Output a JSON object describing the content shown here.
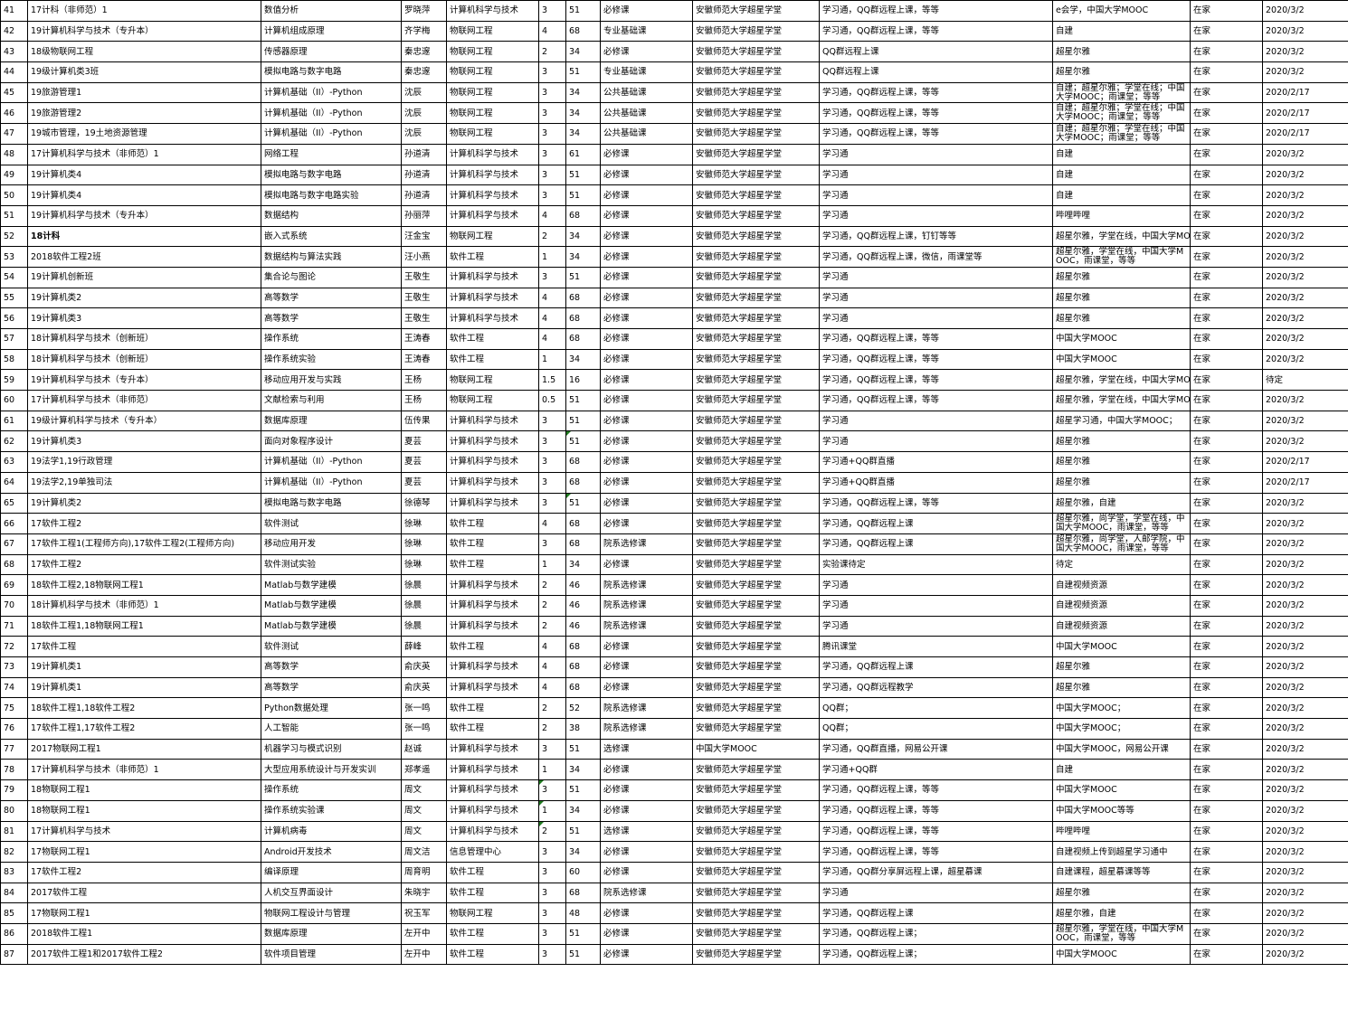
{
  "rows": [
    [
      "41",
      "17计科（非师范）1",
      "数值分析",
      "罗晓萍",
      "计算机科学与技术",
      "3",
      "51",
      "必修课",
      "安徽师范大学超星学堂",
      "学习通，QQ群远程上课，等等",
      "e会学，中国大学MOOC",
      "在家",
      "2020/3/2"
    ],
    [
      "42",
      "19计算机科学与技术（专升本）",
      "计算机组成原理",
      "齐学梅",
      "物联网工程",
      "4",
      "68",
      "专业基础课",
      "安徽师范大学超星学堂",
      "学习通，QQ群远程上课，等等",
      "自建",
      "在家",
      "2020/3/2"
    ],
    [
      "43",
      "18级物联网工程",
      "传感器原理",
      "秦忠邃",
      "物联网工程",
      "2",
      "34",
      "必修课",
      "安徽师范大学超星学堂",
      "QQ群远程上课",
      "超星尔雅",
      "在家",
      "2020/3/2"
    ],
    [
      "44",
      "19级计算机类3班",
      "模拟电路与数字电路",
      "秦忠邃",
      "物联网工程",
      "3",
      "51",
      "专业基础课",
      "安徽师范大学超星学堂",
      "QQ群远程上课",
      "超星尔雅",
      "在家",
      "2020/3/2"
    ],
    [
      "45",
      "19旅游管理1",
      "计算机基础（II）-Python",
      "沈辰",
      "物联网工程",
      "3",
      "34",
      "公共基础课",
      "安徽师范大学超星学堂",
      "学习通，QQ群远程上课，等等",
      "自建；超星尔雅；学堂在线；中国大学MOOC；雨课堂；等等",
      "在家",
      "2020/2/17"
    ],
    [
      "46",
      "19旅游管理2",
      "计算机基础（II）-Python",
      "沈辰",
      "物联网工程",
      "3",
      "34",
      "公共基础课",
      "安徽师范大学超星学堂",
      "学习通，QQ群远程上课，等等",
      "自建；超星尔雅；学堂在线；中国大学MOOC；雨课堂；等等",
      "在家",
      "2020/2/17"
    ],
    [
      "47",
      "19城市管理，19土地资源管理",
      "计算机基础（II）-Python",
      "沈辰",
      "物联网工程",
      "3",
      "34",
      "公共基础课",
      "安徽师范大学超星学堂",
      "学习通，QQ群远程上课，等等",
      "自建；超星尔雅；学堂在线；中国大学MOOC；雨课堂；等等",
      "在家",
      "2020/2/17"
    ],
    [
      "48",
      "17计算机科学与技术（非师范）1",
      "网络工程",
      "孙道清",
      "计算机科学与技术",
      "3",
      "61",
      "必修课",
      "安徽师范大学超星学堂",
      "学习通",
      "自建",
      "在家",
      "2020/3/2"
    ],
    [
      "49",
      "19计算机类4",
      "模拟电路与数字电路",
      "孙道清",
      "计算机科学与技术",
      "3",
      "51",
      "必修课",
      "安徽师范大学超星学堂",
      "学习通",
      "自建",
      "在家",
      "2020/3/2"
    ],
    [
      "50",
      "19计算机类4",
      "模拟电路与数字电路实验",
      "孙道清",
      "计算机科学与技术",
      "3",
      "51",
      "必修课",
      "安徽师范大学超星学堂",
      "学习通",
      "自建",
      "在家",
      "2020/3/2"
    ],
    [
      "51",
      "19计算机科学与技术（专升本）",
      "数据结构",
      "孙丽萍",
      "计算机科学与技术",
      "4",
      "68",
      "必修课",
      "安徽师范大学超星学堂",
      "学习通",
      "哔哩哔哩",
      "在家",
      "2020/3/2"
    ],
    [
      "52",
      "18计科",
      "嵌入式系统",
      "汪金宝",
      "物联网工程",
      "2",
      "34",
      "必修课",
      "安徽师范大学超星学堂",
      "学习通，QQ群远程上课，钉钉等等",
      "超星尔雅，学堂在线，中国大学MOOC",
      "在家",
      "2020/3/2"
    ],
    [
      "53",
      "2018软件工程2班",
      "数据结构与算法实践",
      "汪小燕",
      "软件工程",
      "1",
      "34",
      "必修课",
      "安徽师范大学超星学堂",
      "学习通，QQ群远程上课，微信，雨课堂等",
      "超星尔雅，学堂在线，中国大学MOOC，雨课堂，等等",
      "在家",
      "2020/3/2"
    ],
    [
      "54",
      "19计算机创新班",
      "集合论与图论",
      "王敬生",
      "计算机科学与技术",
      "3",
      "51",
      "必修课",
      "安徽师范大学超星学堂",
      "学习通",
      "超星尔雅",
      "在家",
      "2020/3/2"
    ],
    [
      "55",
      "19计算机类2",
      "高等数学",
      "王敬生",
      "计算机科学与技术",
      "4",
      "68",
      "必修课",
      "安徽师范大学超星学堂",
      "学习通",
      "超星尔雅",
      "在家",
      "2020/3/2"
    ],
    [
      "56",
      "19计算机类3",
      "高等数学",
      "王敬生",
      "计算机科学与技术",
      "4",
      "68",
      "必修课",
      "安徽师范大学超星学堂",
      "学习通",
      "超星尔雅",
      "在家",
      "2020/3/2"
    ],
    [
      "57",
      "18计算机科学与技术（创新班）",
      "操作系统",
      "王涛春",
      "软件工程",
      "4",
      "68",
      "必修课",
      "安徽师范大学超星学堂",
      "学习通，QQ群远程上课，等等",
      "中国大学MOOC",
      "在家",
      "2020/3/2"
    ],
    [
      "58",
      "18计算机科学与技术（创新班）",
      "操作系统实验",
      "王涛春",
      "软件工程",
      "1",
      "34",
      "必修课",
      "安徽师范大学超星学堂",
      "学习通，QQ群远程上课，等等",
      "中国大学MOOC",
      "在家",
      "2020/3/2"
    ],
    [
      "59",
      "19计算机科学与技术（专升本）",
      "移动应用开发与实践",
      "王杨",
      "物联网工程",
      "1.5",
      "16",
      "必修课",
      "安徽师范大学超星学堂",
      "学习通，QQ群远程上课，等等",
      "超星尔雅，学堂在线，中国大学MOOC",
      "在家",
      "待定"
    ],
    [
      "60",
      "17计算机科学与技术（非师范）",
      "文献检索与利用",
      "王杨",
      "物联网工程",
      "0.5",
      "51",
      "必修课",
      "安徽师范大学超星学堂",
      "学习通，QQ群远程上课，等等",
      "超星尔雅，学堂在线，中国大学MOOC",
      "在家",
      "2020/3/2"
    ],
    [
      "61",
      "19级计算机科学与技术（专升本）",
      "数据库原理",
      "伍传果",
      "计算机科学与技术",
      "3",
      "51",
      "必修课",
      "安徽师范大学超星学堂",
      "学习通",
      "超星学习通，中国大学MOOC；",
      "在家",
      "2020/3/2"
    ],
    [
      "62",
      "19计算机类3",
      "面向对象程序设计",
      "夏芸",
      "计算机科学与技术",
      "3",
      "51",
      "必修课",
      "安徽师范大学超星学堂",
      "学习通",
      "超星尔雅",
      "在家",
      "2020/3/2"
    ],
    [
      "63",
      "19法学1,19行政管理",
      "计算机基础（II）-Python",
      "夏芸",
      "计算机科学与技术",
      "3",
      "68",
      "必修课",
      "安徽师范大学超星学堂",
      "学习通+QQ群直播",
      "超星尔雅",
      "在家",
      "2020/2/17"
    ],
    [
      "64",
      "19法学2,19单独司法",
      "计算机基础（II）-Python",
      "夏芸",
      "计算机科学与技术",
      "3",
      "68",
      "必修课",
      "安徽师范大学超星学堂",
      "学习通+QQ群直播",
      "超星尔雅",
      "在家",
      "2020/2/17"
    ],
    [
      "65",
      "19计算机类2",
      "模拟电路与数字电路",
      "徐德琴",
      "计算机科学与技术",
      "3",
      "51",
      "必修课",
      "安徽师范大学超星学堂",
      "学习通，QQ群远程上课，等等",
      "超星尔雅，自建",
      "在家",
      "2020/3/2"
    ],
    [
      "66",
      "17软件工程2",
      "软件测试",
      "徐琳",
      "软件工程",
      "4",
      "68",
      "必修课",
      "安徽师范大学超星学堂",
      "学习通，QQ群远程上课",
      "超星尔雅，尚学堂，学堂在线，中国大学MOOC，雨课堂，等等",
      "在家",
      "2020/3/2"
    ],
    [
      "67",
      "17软件工程1(工程师方向),17软件工程2(工程师方向)",
      "移动应用开发",
      "徐琳",
      "软件工程",
      "3",
      "68",
      "院系选修课",
      "安徽师范大学超星学堂",
      "学习通，QQ群远程上课",
      "超星尔雅，尚学堂，人邮学院，中国大学MOOC，雨课堂，等等",
      "在家",
      "2020/3/2"
    ],
    [
      "68",
      "17软件工程2",
      "软件测试实验",
      "徐琳",
      "软件工程",
      "1",
      "34",
      "必修课",
      "安徽师范大学超星学堂",
      "实验课待定",
      "待定",
      "在家",
      "2020/3/2"
    ],
    [
      "69",
      "18软件工程2,18物联网工程1",
      "Matlab与数学建模",
      "徐晨",
      "计算机科学与技术",
      "2",
      "46",
      "院系选修课",
      "安徽师范大学超星学堂",
      "学习通",
      "自建视频资源",
      "在家",
      "2020/3/2"
    ],
    [
      "70",
      "18计算机科学与技术（非师范）1",
      "Matlab与数学建模",
      "徐晨",
      "计算机科学与技术",
      "2",
      "46",
      "院系选修课",
      "安徽师范大学超星学堂",
      "学习通",
      "自建视频资源",
      "在家",
      "2020/3/2"
    ],
    [
      "71",
      "18软件工程1,18物联网工程1",
      "Matlab与数学建模",
      "徐晨",
      "计算机科学与技术",
      "2",
      "46",
      "院系选修课",
      "安徽师范大学超星学堂",
      "学习通",
      "自建视频资源",
      "在家",
      "2020/3/2"
    ],
    [
      "72",
      "17软件工程",
      "软件测试",
      "薛峰",
      "软件工程",
      "4",
      "68",
      "必修课",
      "安徽师范大学超星学堂",
      "腾讯课堂",
      "中国大学MOOC",
      "在家",
      "2020/3/2"
    ],
    [
      "73",
      "19计算机类1",
      "高等数学",
      "俞庆英",
      "计算机科学与技术",
      "4",
      "68",
      "必修课",
      "安徽师范大学超星学堂",
      "学习通，QQ群远程上课",
      "超星尔雅",
      "在家",
      "2020/3/2"
    ],
    [
      "74",
      "19计算机类1",
      "高等数学",
      "俞庆英",
      "计算机科学与技术",
      "4",
      "68",
      "必修课",
      "安徽师范大学超星学堂",
      "学习通，QQ群远程教学",
      "超星尔雅",
      "在家",
      "2020/3/2"
    ],
    [
      "75",
      "18软件工程1,18软件工程2",
      "Python数据处理",
      "张一鸣",
      "软件工程",
      "2",
      "52",
      "院系选修课",
      "安徽师范大学超星学堂",
      "QQ群；",
      "中国大学MOOC；",
      "在家",
      "2020/3/2"
    ],
    [
      "76",
      "17软件工程1,17软件工程2",
      "人工智能",
      "张一鸣",
      "软件工程",
      "2",
      "38",
      "院系选修课",
      "安徽师范大学超星学堂",
      "QQ群；",
      "中国大学MOOC；",
      "在家",
      "2020/3/2"
    ],
    [
      "77",
      "2017物联网工程1",
      "机器学习与模式识别",
      "赵诚",
      "计算机科学与技术",
      "3",
      "51",
      "选修课",
      "中国大学MOOC",
      "学习通，QQ群直播，网易公开课",
      "中国大学MOOC，网易公开课",
      "在家",
      "2020/3/2"
    ],
    [
      "78",
      "17计算机科学与技术（非师范）1",
      "大型应用系统设计与开发实训",
      "郑孝遥",
      "计算机科学与技术",
      "1",
      "34",
      "必修课",
      "安徽师范大学超星学堂",
      "学习通+QQ群",
      "自建",
      "在家",
      "2020/3/2"
    ],
    [
      "79",
      "18物联网工程1",
      "操作系统",
      "周文",
      "计算机科学与技术",
      "3",
      "51",
      "必修课",
      "安徽师范大学超星学堂",
      "学习通，QQ群远程上课，等等",
      "中国大学MOOC",
      "在家",
      "2020/3/2"
    ],
    [
      "80",
      "18物联网工程1",
      "操作系统实验课",
      "周文",
      "计算机科学与技术",
      "1",
      "34",
      "必修课",
      "安徽师范大学超星学堂",
      "学习通，QQ群远程上课，等等",
      "中国大学MOOC等等",
      "在家",
      "2020/3/2"
    ],
    [
      "81",
      "17计算机科学与技术",
      "计算机病毒",
      "周文",
      "计算机科学与技术",
      "2",
      "51",
      "选修课",
      "安徽师范大学超星学堂",
      "学习通，QQ群远程上课，等等",
      "哔哩哔哩",
      "在家",
      "2020/3/2"
    ],
    [
      "82",
      "17物联网工程1",
      "Android开发技术",
      "周文洁",
      "信息管理中心",
      "3",
      "34",
      "必修课",
      "安徽师范大学超星学堂",
      "学习通，QQ群远程上课，等等",
      "自建视频上传到超星学习通中",
      "在家",
      "2020/3/2"
    ],
    [
      "83",
      "17软件工程2",
      "编译原理",
      "周育明",
      "软件工程",
      "3",
      "60",
      "必修课",
      "安徽师范大学超星学堂",
      "学习通，QQ群分享屏远程上课，超星慕课",
      "自建课程，超星慕课等等",
      "在家",
      "2020/3/2"
    ],
    [
      "84",
      "2017软件工程",
      "人机交互界面设计",
      "朱晓宇",
      "软件工程",
      "3",
      "68",
      "院系选修课",
      "安徽师范大学超星学堂",
      "学习通",
      "超星尔雅",
      "在家",
      "2020/3/2"
    ],
    [
      "85",
      "17物联网工程1",
      "物联网工程设计与管理",
      "祝玉军",
      "物联网工程",
      "3",
      "48",
      "必修课",
      "安徽师范大学超星学堂",
      "学习通，QQ群远程上课",
      "超星尔雅，自建",
      "在家",
      "2020/3/2"
    ],
    [
      "86",
      "2018软件工程1",
      "数据库原理",
      "左开中",
      "软件工程",
      "3",
      "51",
      "必修课",
      "安徽师范大学超星学堂",
      "学习通，QQ群远程上课；",
      "超星尔雅，学堂在线，中国大学MOOC，雨课堂，等等",
      "在家",
      "2020/3/2"
    ],
    [
      "87",
      "2017软件工程1和2017软件工程2",
      "软件项目管理",
      "左开中",
      "软件工程",
      "3",
      "51",
      "必修课",
      "安徽师范大学超星学堂",
      "学习通，QQ群远程上课；",
      "中国大学MOOC",
      "在家",
      "2020/3/2"
    ]
  ]
}
